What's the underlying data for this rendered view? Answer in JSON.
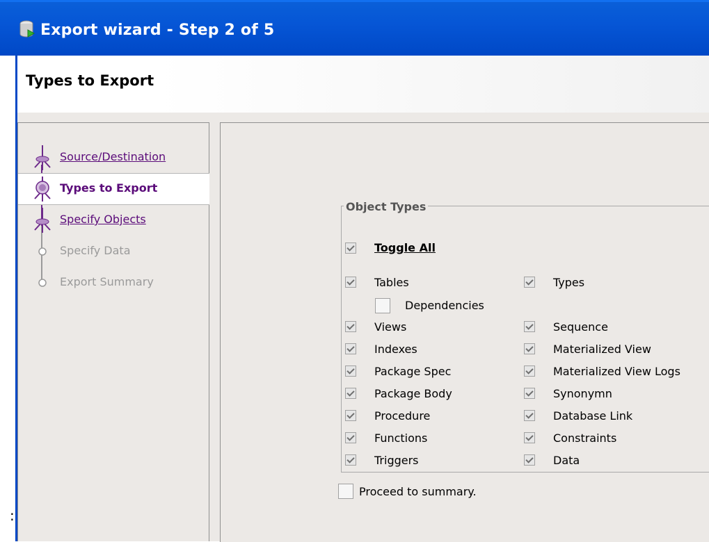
{
  "window": {
    "title": "Export wizard - Step 2 of 5",
    "icon": "database-export-icon"
  },
  "header": {
    "title": "Types to Export"
  },
  "side_mark": ":",
  "steps": [
    {
      "label": "Source/Destination",
      "state": "done"
    },
    {
      "label": "Types to Export",
      "state": "active"
    },
    {
      "label": "Specify Objects",
      "state": "done"
    },
    {
      "label": "Specify Data",
      "state": "pending"
    },
    {
      "label": "Export Summary",
      "state": "pending"
    }
  ],
  "object_types": {
    "legend": "Object Types",
    "toggle_all": {
      "label": "Toggle All",
      "checked": true
    },
    "left_column": [
      {
        "label": "Tables",
        "checked": true
      },
      {
        "label": "Dependencies",
        "checked": false
      },
      {
        "label": "Views",
        "checked": true
      },
      {
        "label": "Indexes",
        "checked": true
      },
      {
        "label": "Package Spec",
        "checked": true
      },
      {
        "label": "Package Body",
        "checked": true
      },
      {
        "label": "Procedure",
        "checked": true
      },
      {
        "label": "Functions",
        "checked": true
      },
      {
        "label": "Triggers",
        "checked": true
      }
    ],
    "right_column": [
      {
        "label": "Types",
        "checked": true
      },
      {
        "label": "Sequence",
        "checked": true
      },
      {
        "label": "Materialized View",
        "checked": true
      },
      {
        "label": "Materialized View Logs",
        "checked": true
      },
      {
        "label": "Synonymn",
        "checked": true
      },
      {
        "label": "Database Link",
        "checked": true
      },
      {
        "label": "Constraints",
        "checked": true
      },
      {
        "label": "Data",
        "checked": true
      }
    ]
  },
  "proceed": {
    "label": "Proceed to summary.",
    "checked": false
  },
  "colors": {
    "title_bar": "#0656d6",
    "step_link": "#5b0c7a",
    "panel_bg": "#ece9e6"
  }
}
